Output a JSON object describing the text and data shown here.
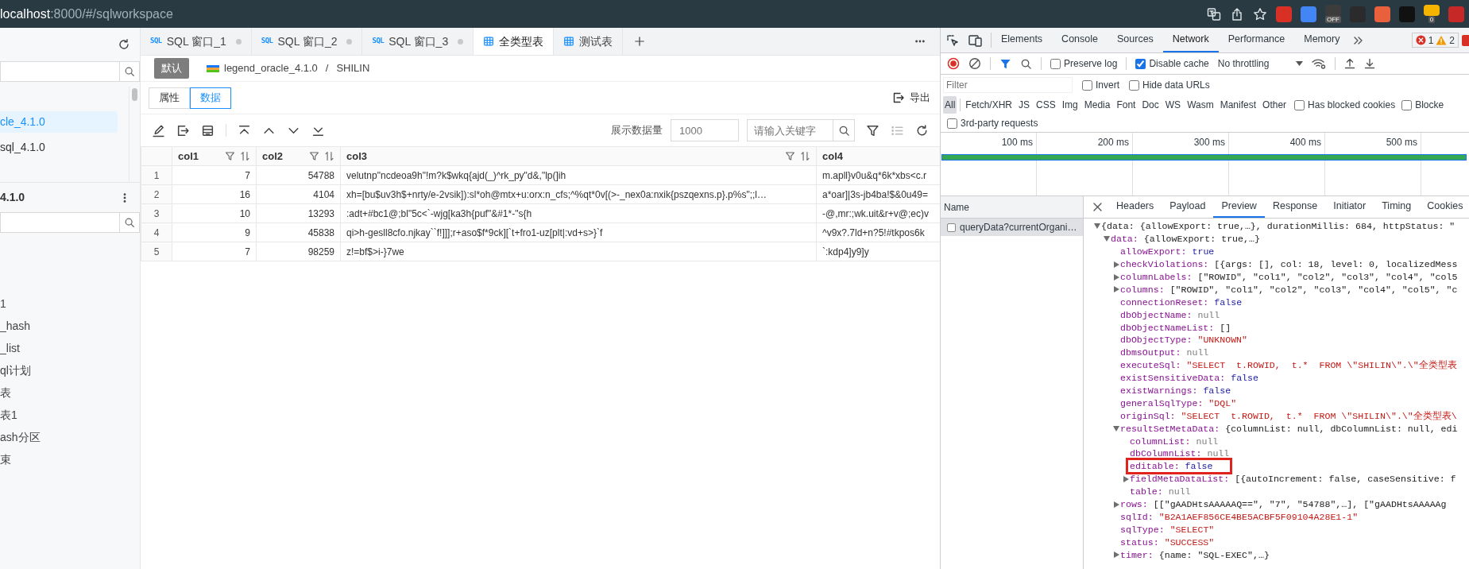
{
  "browser": {
    "url_host": "localhost",
    "url_path": ":8000/#/sqlworkspace",
    "extensions": [
      {
        "color": "#d93025"
      },
      {
        "color": "#4285f4"
      },
      {
        "color": "#3c3c3c",
        "badge": "OFF"
      },
      {
        "color": "#2b2b2b"
      },
      {
        "color": "#e8603c"
      },
      {
        "color": "#111111"
      },
      {
        "color": "#f4b400",
        "badge": "0"
      },
      {
        "color": "#c62828"
      }
    ]
  },
  "sidebar": {
    "connections": [
      {
        "label": "cle_4.1.0",
        "selected": true
      },
      {
        "label": "sql_4.1.0",
        "selected": false
      }
    ],
    "schema_title": "4.1.0",
    "objects": [
      {
        "label": "1"
      },
      {
        "label": "_hash"
      },
      {
        "label": "_list"
      },
      {
        "label": "ql计划"
      },
      {
        "label": "表"
      },
      {
        "label": "表1"
      },
      {
        "label": "ash分区"
      },
      {
        "label": "束"
      }
    ]
  },
  "tabs": [
    {
      "kind": "sql",
      "icon_label": "SQL",
      "label": "SQL 窗口_1",
      "selected": false,
      "modified": true
    },
    {
      "kind": "sql",
      "icon_label": "SQL",
      "label": "SQL 窗口_2",
      "selected": false,
      "modified": true
    },
    {
      "kind": "sql",
      "icon_label": "SQL",
      "label": "SQL 窗口_3",
      "selected": false,
      "modified": true
    },
    {
      "kind": "table",
      "label": "全类型表",
      "selected": true,
      "modified": false
    },
    {
      "kind": "table",
      "label": "测试表",
      "selected": false,
      "modified": false
    }
  ],
  "breadcrumb": {
    "badge": "默认",
    "database": "legend_oracle_4.1.0",
    "separator": "/",
    "schema": "SHILIN"
  },
  "view_switch": [
    {
      "label": "属性",
      "selected": false
    },
    {
      "label": "数据",
      "selected": true
    }
  ],
  "export_label": "导出",
  "toolbar": {
    "limit_label": "展示数据量",
    "limit_placeholder": "1000",
    "search_placeholder": "请输入关键字",
    "column_list_disabled": true
  },
  "table": {
    "columns": [
      {
        "label": "col1",
        "numeric": true,
        "tools": true
      },
      {
        "label": "col2",
        "numeric": true,
        "tools": true
      },
      {
        "label": "col3",
        "numeric": false,
        "tools": true
      },
      {
        "label": "col4",
        "numeric": false,
        "tools": false
      }
    ],
    "rows": [
      {
        "index": "1",
        "cells": [
          "7",
          "54788",
          "velutnp\"ncdeoa9h\"!m?k$wkq{ajd(_)^rk_py\"d&,\"lp(]ih",
          "m.apll}v0u&q*6k*xbs<c.r"
        ]
      },
      {
        "index": "2",
        "cells": [
          "16",
          "4104",
          "xh=[bu$uv3h$+nrty/e-2vsik]):sl*oh@mtx+u:orx:n_cfs;^%qt*0v[(>-_nex0a:nxik{pszqexns.p}.p%s\";;l…",
          "a*oar]|3s-jb4ba!$&0u49="
        ]
      },
      {
        "index": "3",
        "cells": [
          "10",
          "13293",
          ":adt+#bc1@;bl\"5c<`-wjg[ka3h{puf\"&#1*-\"s{h",
          "-@,mr:;wk.uit&r+v@;ec)v"
        ]
      },
      {
        "index": "4",
        "cells": [
          "9",
          "45838",
          "qi>h-gesll8cfo.njkay``f!]]];r+aso$f*9ck][`t+fro1-uz[plt|:vd+s>}`f",
          "^v9x?.7ld+n?5!#tkpos6k"
        ]
      },
      {
        "index": "5",
        "cells": [
          "7",
          "98259",
          "z!=bf$>i-}7we",
          "`:kdp4]y9]y"
        ]
      }
    ]
  },
  "devtools": {
    "tabs": [
      {
        "label": "Elements",
        "selected": false
      },
      {
        "label": "Console",
        "selected": false
      },
      {
        "label": "Sources",
        "selected": false
      },
      {
        "label": "Network",
        "selected": true
      },
      {
        "label": "Performance",
        "selected": false
      },
      {
        "label": "Memory",
        "selected": false
      }
    ],
    "error_count": "1",
    "warning_count": "2",
    "preserve_log": {
      "label": "Preserve log",
      "checked": false
    },
    "disable_cache": {
      "label": "Disable cache",
      "checked": true
    },
    "throttling": "No throttling",
    "filter_placeholder": "Filter",
    "filter_options": [
      {
        "label": "Invert",
        "checked": false
      },
      {
        "label": "Hide data URLs",
        "checked": false
      }
    ],
    "types": [
      {
        "label": "All",
        "selected": true
      },
      {
        "label": "Fetch/XHR",
        "selected": false
      },
      {
        "label": "JS",
        "selected": false
      },
      {
        "label": "CSS",
        "selected": false
      },
      {
        "label": "Img",
        "selected": false
      },
      {
        "label": "Media",
        "selected": false
      },
      {
        "label": "Font",
        "selected": false
      },
      {
        "label": "Doc",
        "selected": false
      },
      {
        "label": "WS",
        "selected": false
      },
      {
        "label": "Wasm",
        "selected": false
      },
      {
        "label": "Manifest",
        "selected": false
      },
      {
        "label": "Other",
        "selected": false
      }
    ],
    "type_options": [
      {
        "label": "Has blocked cookies",
        "checked": false
      },
      {
        "label": "Blocke",
        "checked": false
      }
    ],
    "third_party": {
      "label": "3rd-party requests",
      "checked": false
    },
    "timeline_ticks": [
      "100 ms",
      "200 ms",
      "300 ms",
      "400 ms",
      "500 ms"
    ],
    "name_header": "Name",
    "requests": [
      {
        "name": "queryData?currentOrgani…",
        "selected": true
      }
    ],
    "detail_tabs": [
      {
        "label": "Headers",
        "selected": false
      },
      {
        "label": "Payload",
        "selected": false
      },
      {
        "label": "Preview",
        "selected": true
      },
      {
        "label": "Response",
        "selected": false
      },
      {
        "label": "Initiator",
        "selected": false
      },
      {
        "label": "Timing",
        "selected": false
      },
      {
        "label": "Cookies",
        "selected": false
      }
    ],
    "preview": {
      "value": "{data: {allowExport: true,…}, durationMillis: 684, httpStatus: \"",
      "kind": "object",
      "expanded": true,
      "children": [
        {
          "key": "data:",
          "value": "{allowExport: true,…}",
          "kind": "object",
          "expanded": true,
          "children": [
            {
              "key": "allowExport:",
              "value": "true",
              "kind": "boolean"
            },
            {
              "key": "checkViolations:",
              "value": "[{args: [], col: 18, level: 0, localizedMess",
              "kind": "object",
              "expanded": false
            },
            {
              "key": "columnLabels:",
              "value": "[\"ROWID\", \"col1\", \"col2\", \"col3\", \"col4\", \"col5",
              "kind": "object",
              "expanded": false
            },
            {
              "key": "columns:",
              "value": "[\"ROWID\", \"col1\", \"col2\", \"col3\", \"col4\", \"col5\", \"c",
              "kind": "object",
              "expanded": false
            },
            {
              "key": "connectionReset:",
              "value": "false",
              "kind": "boolean"
            },
            {
              "key": "dbObjectName:",
              "value": "null",
              "kind": "null"
            },
            {
              "key": "dbObjectNameList:",
              "value": "[]",
              "kind": "object"
            },
            {
              "key": "dbObjectType:",
              "value": "\"UNKNOWN\"",
              "kind": "string"
            },
            {
              "key": "dbmsOutput:",
              "value": "null",
              "kind": "null"
            },
            {
              "key": "executeSql:",
              "value": "\"SELECT  t.ROWID,  t.*  FROM \\\"SHILIN\\\".\\\"全类型表",
              "kind": "string"
            },
            {
              "key": "existSensitiveData:",
              "value": "false",
              "kind": "boolean"
            },
            {
              "key": "existWarnings:",
              "value": "false",
              "kind": "boolean"
            },
            {
              "key": "generalSqlType:",
              "value": "\"DQL\"",
              "kind": "string"
            },
            {
              "key": "originSql:",
              "value": "\"SELECT  t.ROWID,  t.*  FROM \\\"SHILIN\\\".\\\"全类型表\\",
              "kind": "string"
            },
            {
              "key": "resultSetMetaData:",
              "value": "{columnList: null, dbColumnList: null, edi",
              "kind": "object",
              "expanded": true,
              "children": [
                {
                  "key": "columnList:",
                  "value": "null",
                  "kind": "null",
                  "highlighted": false
                },
                {
                  "key": "dbColumnList:",
                  "value": "null",
                  "kind": "null",
                  "highlighted": false
                },
                {
                  "key": "editable:",
                  "value": "false",
                  "kind": "boolean",
                  "highlighted": true
                },
                {
                  "key": "fieldMetaDataList:",
                  "value": "[{autoIncrement: false, caseSensitive: f",
                  "kind": "object",
                  "expanded": false,
                  "highlighted": false
                },
                {
                  "key": "table:",
                  "value": "null",
                  "kind": "null",
                  "highlighted": false
                }
              ]
            },
            {
              "key": "rows:",
              "value": "[[\"gAADHtsAAAAAQ==\", \"7\", \"54788\",…], [\"gAADHtsAAAAAg",
              "kind": "object",
              "expanded": false
            },
            {
              "key": "sqlId:",
              "value": "\"B2A1AEF856CE4BE5ACBF5F09104A28E1-1\"",
              "kind": "string"
            },
            {
              "key": "sqlType:",
              "value": "\"SELECT\"",
              "kind": "string"
            },
            {
              "key": "status:",
              "value": "\"SUCCESS\"",
              "kind": "string"
            },
            {
              "key": "timer:",
              "value": "{name: \"SQL-EXEC\",…}",
              "kind": "object",
              "expanded": false
            }
          ]
        }
      ]
    }
  }
}
